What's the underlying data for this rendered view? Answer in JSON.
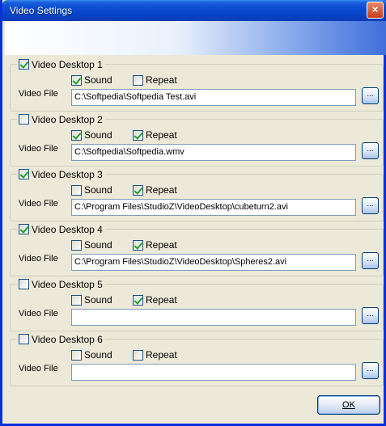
{
  "window": {
    "title": "Video Settings",
    "close_glyph": "×"
  },
  "desktops": [
    {
      "title": "Video Desktop 1",
      "enabled": true,
      "sound": true,
      "repeat": false,
      "video_file_label": "Video File",
      "path": "C:\\Softpedia\\Softpedia Test.avi",
      "browse_label": "..."
    },
    {
      "title": "Video Desktop 2",
      "enabled": false,
      "sound": true,
      "repeat": true,
      "video_file_label": "Video File",
      "path": "C:\\Softpedia\\Softpedia.wmv",
      "browse_label": "..."
    },
    {
      "title": "Video Desktop 3",
      "enabled": true,
      "sound": false,
      "repeat": true,
      "video_file_label": "Video File",
      "path": "C:\\Program Files\\StudioZ\\VideoDesktop\\cubeturn2.avi",
      "browse_label": "..."
    },
    {
      "title": "Video Desktop 4",
      "enabled": true,
      "sound": false,
      "repeat": true,
      "video_file_label": "Video File",
      "path": "C:\\Program Files\\StudioZ\\VideoDesktop\\Spheres2.avi",
      "browse_label": "..."
    },
    {
      "title": "Video Desktop 5",
      "enabled": false,
      "sound": false,
      "repeat": true,
      "video_file_label": "Video File",
      "path": "",
      "browse_label": "..."
    },
    {
      "title": "Video Desktop 6",
      "enabled": false,
      "sound": false,
      "repeat": false,
      "video_file_label": "Video File",
      "path": "",
      "browse_label": "..."
    }
  ],
  "labels": {
    "sound": "Sound",
    "repeat": "Repeat"
  },
  "ok_label": "OK",
  "colors": {
    "titlebar": "#0a4cd3",
    "window_bg": "#ece9d8",
    "checkmark": "#21a121"
  }
}
